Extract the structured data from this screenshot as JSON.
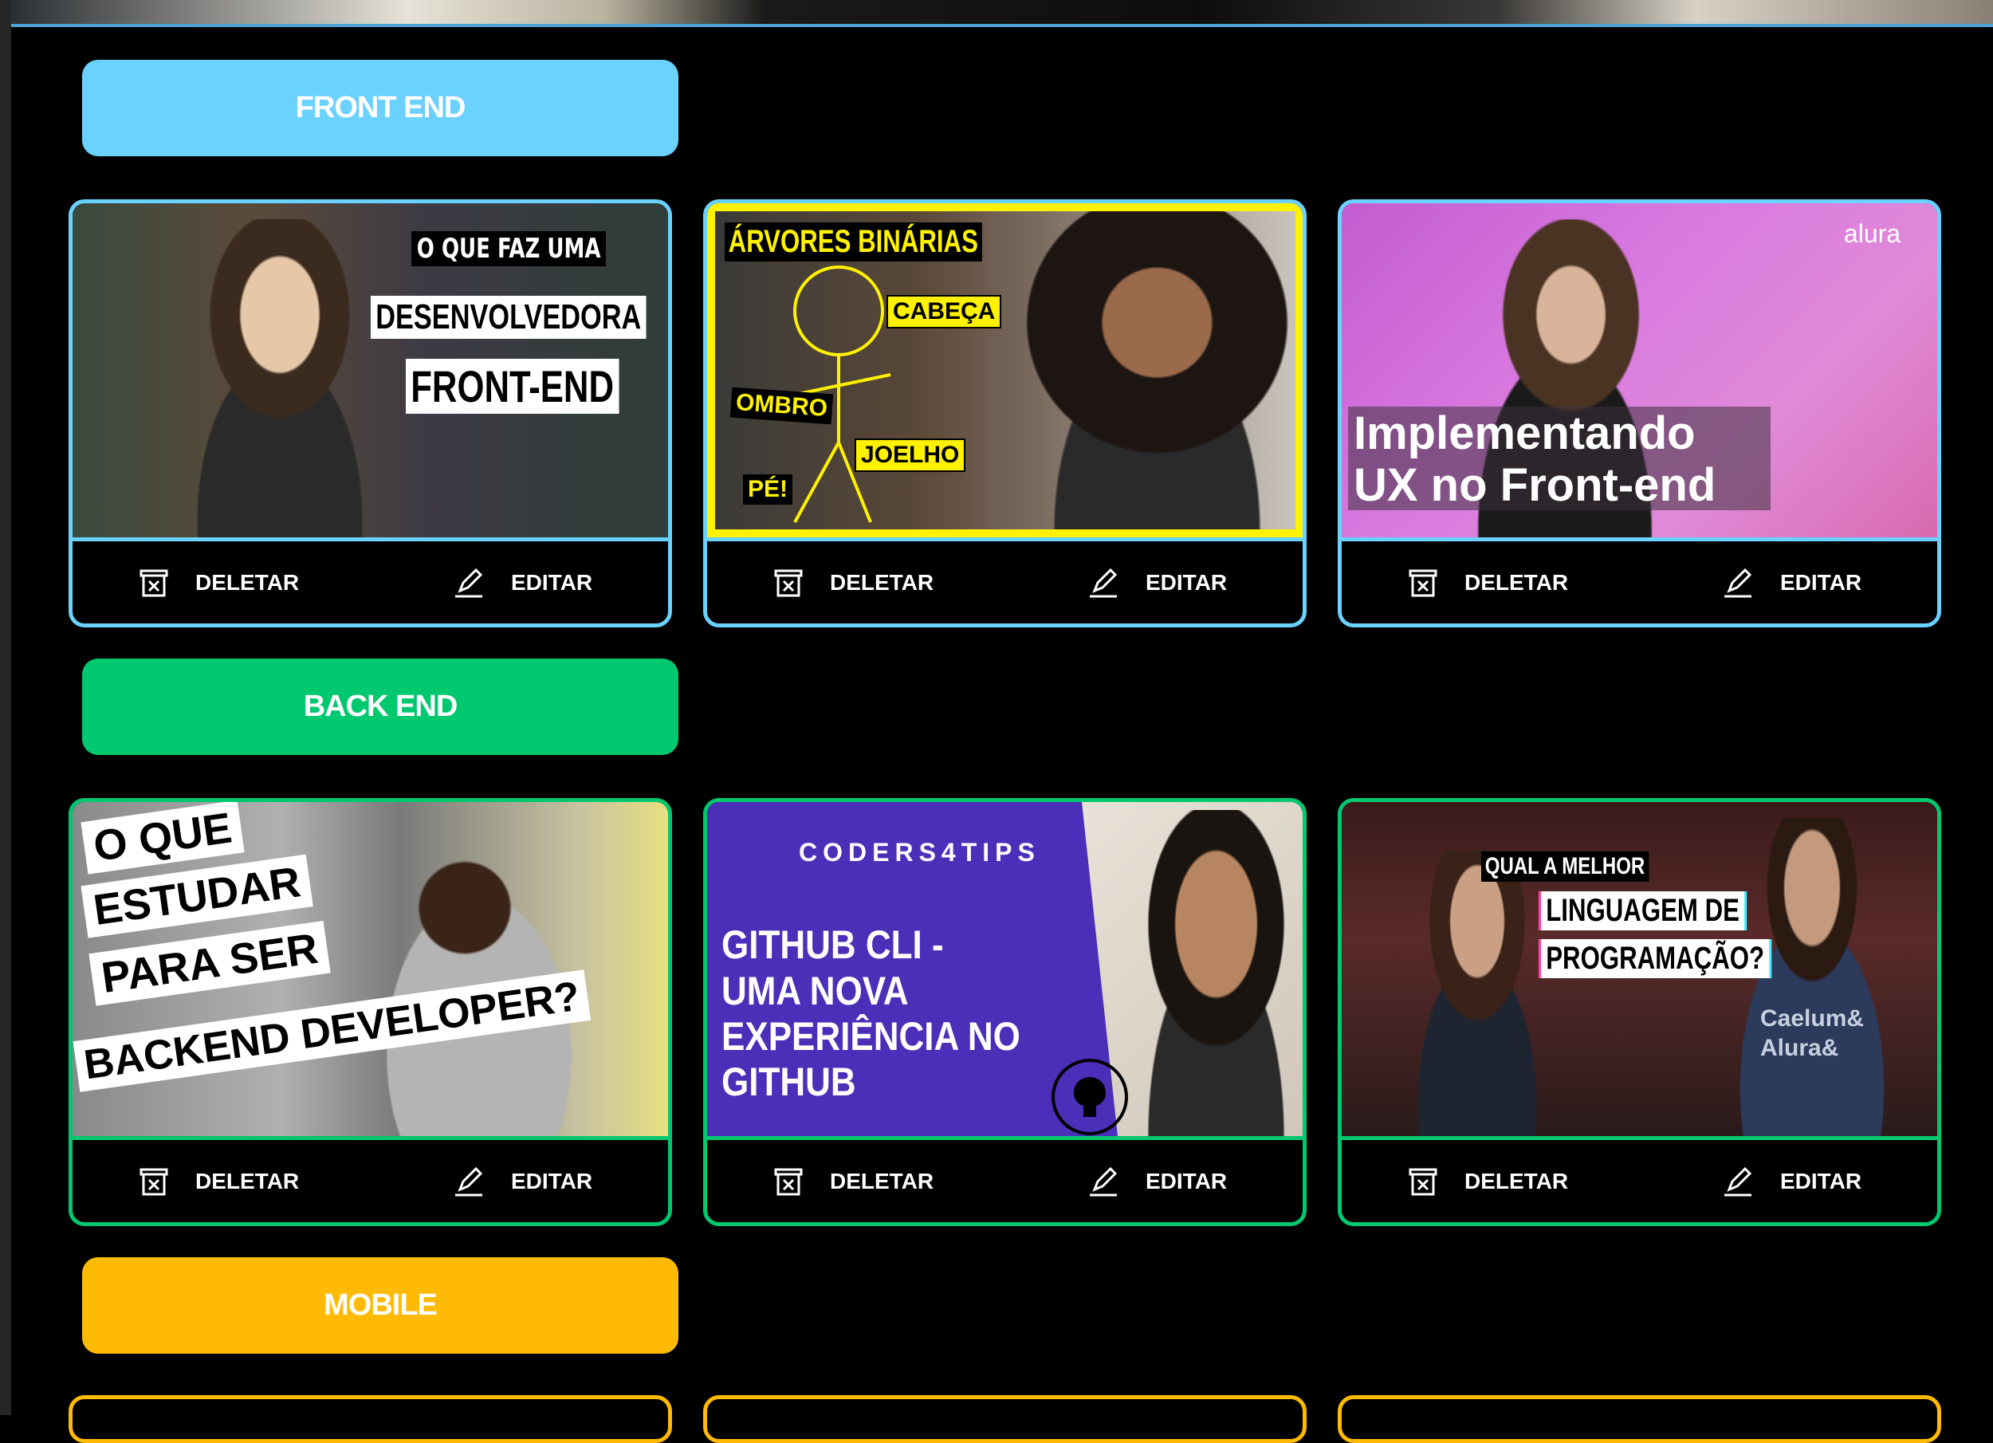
{
  "colors": {
    "front_end": "#6bd1ff",
    "back_end": "#00c86f",
    "mobile": "#ffba05",
    "background": "#000000"
  },
  "categories": [
    {
      "name": "FRONT END",
      "videos": [
        {
          "thumb_lines": [
            "O QUE FAZ UMA",
            "DESENVOLVEDORA",
            "FRONT-END"
          ]
        },
        {
          "thumb_lines": [
            "ÁRVORES BINÁRIAS",
            "CABEÇA",
            "OMBRO",
            "JOELHO",
            "PÉ!"
          ]
        },
        {
          "thumb_lines": [
            "Implementando",
            "UX no Front-end",
            "alura"
          ]
        }
      ]
    },
    {
      "name": "BACK END",
      "videos": [
        {
          "thumb_lines": [
            "O QUE",
            "ESTUDAR",
            "PARA SER",
            "BACKEND DEVELOPER?"
          ]
        },
        {
          "thumb_lines": [
            "CODERS4TIPS",
            "GITHUB CLI -",
            "UMA NOVA",
            "EXPERIÊNCIA NO",
            "GITHUB"
          ]
        },
        {
          "thumb_lines": [
            "QUAL A MELHOR",
            "LINGUAGEM DE",
            "PROGRAMAÇÃO?",
            "Caelum&",
            "Alura&"
          ]
        }
      ]
    },
    {
      "name": "MOBILE",
      "videos": []
    }
  ],
  "card_actions": {
    "delete_label": "DELETAR",
    "edit_label": "EDITAR",
    "delete_icon": "trash-icon",
    "edit_icon": "pencil-icon"
  }
}
